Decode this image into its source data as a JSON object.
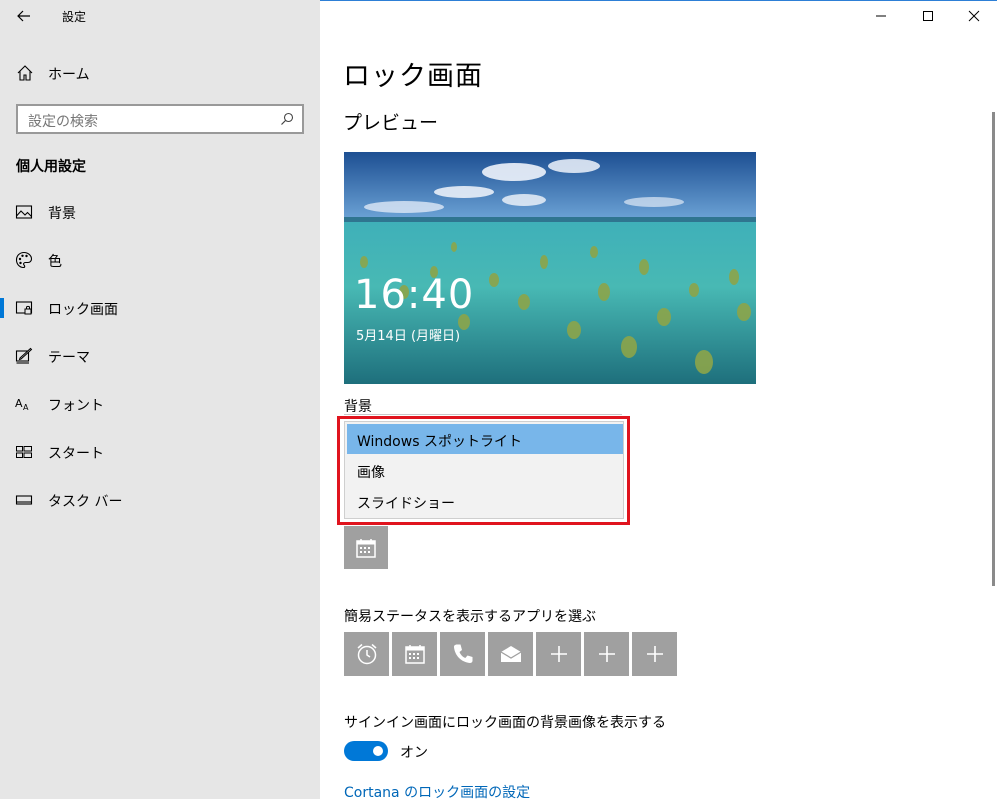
{
  "window": {
    "title": "設定",
    "controls": {
      "minimize": "minimize-icon",
      "maximize": "maximize-icon",
      "close": "close-icon"
    }
  },
  "sidebar": {
    "home_label": "ホーム",
    "search_placeholder": "設定の検索",
    "section_title": "個人用設定",
    "items": [
      {
        "label": "背景",
        "icon": "picture-icon"
      },
      {
        "label": "色",
        "icon": "palette-icon"
      },
      {
        "label": "ロック画面",
        "icon": "lock-screen-icon",
        "active": true
      },
      {
        "label": "テーマ",
        "icon": "theme-icon"
      },
      {
        "label": "フォント",
        "icon": "font-icon"
      },
      {
        "label": "スタート",
        "icon": "start-icon"
      },
      {
        "label": "タスク バー",
        "icon": "taskbar-icon"
      }
    ]
  },
  "main": {
    "page_title": "ロック画面",
    "preview_heading": "プレビュー",
    "preview": {
      "time": "16:40",
      "date": "5月14日 (月曜日)"
    },
    "background_label": "背景",
    "background_options": [
      "Windows スポットライト",
      "画像",
      "スライドショー"
    ],
    "background_selected": "Windows スポットライト",
    "quick_status_label": "簡易ステータスを表示するアプリを選ぶ",
    "quick_status_apps": [
      "alarm-clock-icon",
      "calendar-icon",
      "phone-icon",
      "mail-icon",
      "plus-icon",
      "plus-icon",
      "plus-icon"
    ],
    "signin_label": "サインイン画面にロック画面の背景画像を表示する",
    "signin_toggle": "オン",
    "cortana_link": "Cortana のロック画面の設定"
  },
  "colors": {
    "accent": "#0078d7",
    "sidebar_bg": "#e6e6e6",
    "selected_option": "#78b6ea",
    "highlight_box": "#e0141e",
    "tile_bg": "#a0a0a0",
    "link": "#0067b8"
  }
}
